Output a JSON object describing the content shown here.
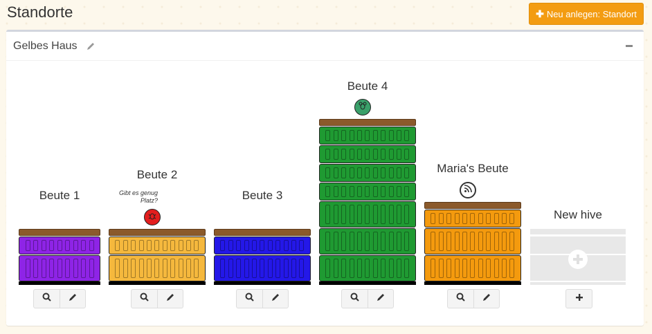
{
  "page": {
    "title": "Standorte"
  },
  "header": {
    "new_button_label": "Neu anlegen: Standort",
    "new_button_icon": "plus-icon",
    "accent": "#f39c12"
  },
  "location": {
    "name": "Gelbes Haus",
    "edit_icon": "pencil-icon",
    "collapse_icon": "minus-icon"
  },
  "hives": [
    {
      "name": "Beute 1",
      "color": "#8e24e6",
      "boxes": 2,
      "status": null,
      "note": ""
    },
    {
      "name": "Beute 2",
      "color": "#f5b83d",
      "boxes": 2,
      "status": {
        "icon": "bug-icon",
        "color": "#e31e1e"
      },
      "note_line1": "Gibt es genug",
      "note_line2": "Platz?"
    },
    {
      "name": "Beute 3",
      "color": "#2418e8",
      "boxes": 2,
      "status": null,
      "note": ""
    },
    {
      "name": "Beute 4",
      "color": "#1f9a32",
      "boxes": 7,
      "status": {
        "icon": "bee-icon",
        "color": "#3aa06a"
      },
      "note": ""
    },
    {
      "name": "Maria's Beute",
      "color": "#f49a0e",
      "boxes": 3,
      "status": {
        "icon": "rss-icon",
        "color": "#ffffff"
      },
      "note": ""
    }
  ],
  "new_hive": {
    "label": "New hive",
    "icon": "plus-icon"
  },
  "actions": {
    "inspect_icon": "search-icon",
    "edit_icon": "pencil-icon",
    "add_icon": "plus-icon"
  }
}
